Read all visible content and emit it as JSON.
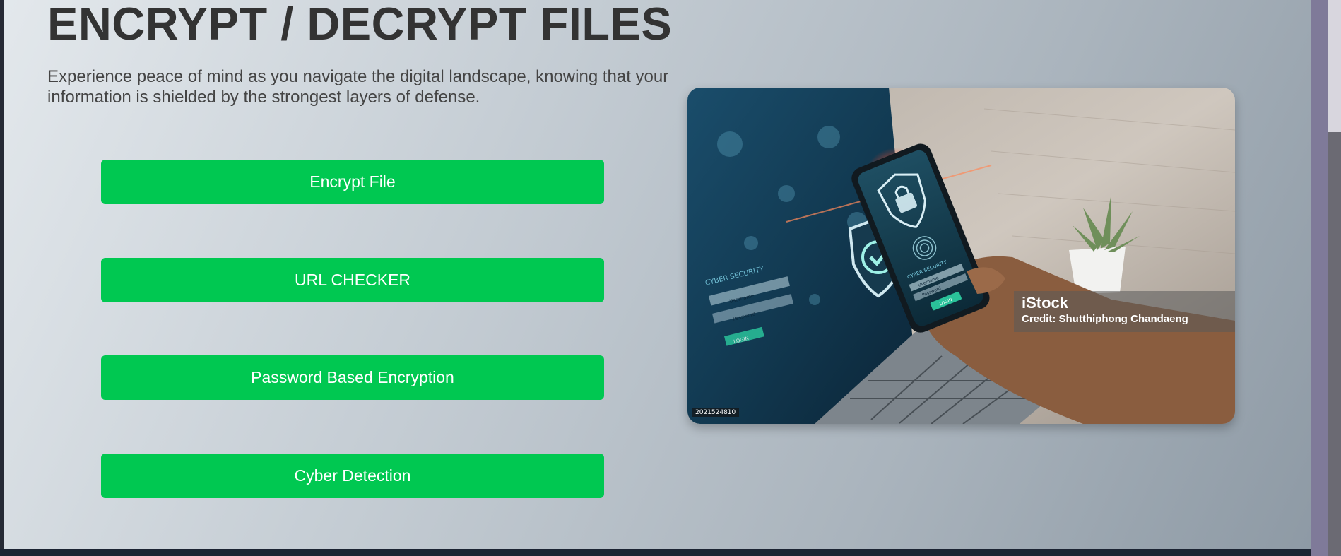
{
  "header": {
    "title": "ENCRYPT / DECRYPT FILES",
    "subtitle": "Experience peace of mind as you navigate the digital landscape, knowing that your information is shielded by the strongest layers of defense."
  },
  "buttons": [
    {
      "label": "Encrypt File"
    },
    {
      "label": "URL CHECKER"
    },
    {
      "label": "Password Based Encryption"
    },
    {
      "label": "Cyber Detection"
    }
  ],
  "hero_image": {
    "icons": [
      "shield-check-icon",
      "lock-shield-icon",
      "fingerprint-icon"
    ],
    "watermark": {
      "logo": "iStock",
      "credit": "Credit: Shutthiphong Chandaeng"
    },
    "image_id": "2021524810",
    "screen_text": {
      "laptop_label": "CYBER SECURITY",
      "laptop_field_1": "Username",
      "laptop_field_2": "Password",
      "laptop_button": "LOGIN",
      "phone_label": "CYBER SECURITY",
      "phone_field_1": "Username",
      "phone_field_2": "Password",
      "phone_button": "LOGIN"
    }
  },
  "colors": {
    "button_bg": "#00c851",
    "button_text": "#ffffff",
    "title": "#333333",
    "subtitle": "#444444"
  }
}
